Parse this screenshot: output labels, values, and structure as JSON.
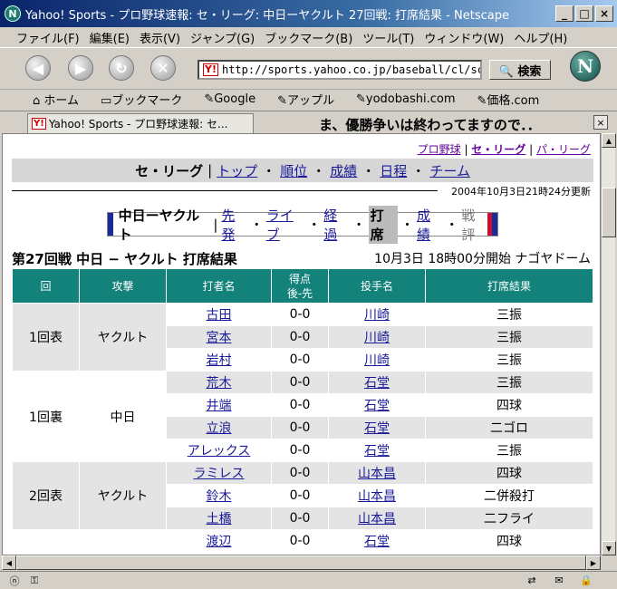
{
  "window": {
    "title": "Yahoo! Sports - プロ野球速報: セ・リーグ: 中日ーヤクルト 27回戦: 打席結果 - Netscape",
    "app_icon_letter": "N",
    "buttons": [
      "_",
      "□",
      "×"
    ]
  },
  "menu": [
    "ファイル(F)",
    "編集(E)",
    "表示(V)",
    "ジャンプ(G)",
    "ブックマーク(B)",
    "ツール(T)",
    "ウィンドウ(W)",
    "ヘルプ(H)"
  ],
  "nav": {
    "back_glyph": "◀",
    "forward_glyph": "▶",
    "reload_glyph": "↻",
    "stop_glyph": "✕",
    "url_icon": "Y!",
    "url": "http://sports.yahoo.co.jp/baseball/cl/score",
    "search_label": "🔍 検索",
    "logo_letter": "N"
  },
  "personal_toolbar": [
    "ホーム",
    "ブックマーク",
    "Google",
    "アップル",
    "yodobashi.com",
    "価格.com"
  ],
  "tab": {
    "label": "Yahoo! Sports - プロ野球速報: セ...",
    "icon": "Y!",
    "message": "ま、優勝争いは終わってますので．．",
    "close": "×"
  },
  "page": {
    "toplinks": [
      "プロ野球",
      "セ・リーグ",
      "パ・リーグ"
    ],
    "category": {
      "current": "セ・リーグ",
      "links": [
        "トップ",
        "順位",
        "成績",
        "日程",
        "チーム"
      ]
    },
    "updated": "2004年10月3日21時24分更新",
    "subnav": {
      "matchup": "中日ーヤクルト",
      "items": [
        "先発",
        "ライブ",
        "経過"
      ],
      "active": "打席",
      "link_after": "成績",
      "disabled": "戦評"
    },
    "game_title": "第27回戦 中日 − ヤクルト 打席結果",
    "game_info": "10月3日 18時00分開始 ナゴヤドーム",
    "table": {
      "headers": [
        "回",
        "攻撃",
        "打者名",
        "得点\n後-先",
        "投手名",
        "打席結果"
      ],
      "groups": [
        {
          "inning": "1回表",
          "team": "ヤクルト",
          "rows": [
            {
              "batter": "古田",
              "score": "0-0",
              "pitcher": "川崎",
              "result": "三振"
            },
            {
              "batter": "宮本",
              "score": "0-0",
              "pitcher": "川崎",
              "result": "三振"
            },
            {
              "batter": "岩村",
              "score": "0-0",
              "pitcher": "川崎",
              "result": "三振"
            }
          ]
        },
        {
          "inning": "1回裏",
          "team": "中日",
          "rows": [
            {
              "batter": "荒木",
              "score": "0-0",
              "pitcher": "石堂",
              "result": "三振"
            },
            {
              "batter": "井端",
              "score": "0-0",
              "pitcher": "石堂",
              "result": "四球"
            },
            {
              "batter": "立浪",
              "score": "0-0",
              "pitcher": "石堂",
              "result": "二ゴロ"
            },
            {
              "batter": "アレックス",
              "score": "0-0",
              "pitcher": "石堂",
              "result": "三振"
            }
          ]
        },
        {
          "inning": "2回表",
          "team": "ヤクルト",
          "rows": [
            {
              "batter": "ラミレス",
              "score": "0-0",
              "pitcher": "山本昌",
              "result": "四球"
            },
            {
              "batter": "鈴木",
              "score": "0-0",
              "pitcher": "山本昌",
              "result": "二併殺打"
            },
            {
              "batter": "土橋",
              "score": "0-0",
              "pitcher": "山本昌",
              "result": "二フライ"
            }
          ]
        },
        {
          "inning": "",
          "team": "",
          "rows": [
            {
              "batter": "渡辺",
              "score": "0-0",
              "pitcher": "石堂",
              "result": "四球"
            }
          ]
        }
      ]
    }
  }
}
